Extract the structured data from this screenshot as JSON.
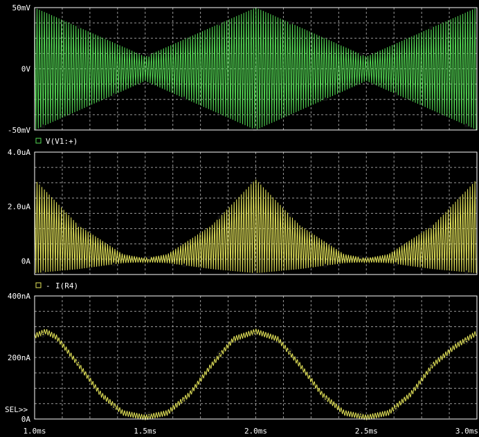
{
  "plot_area": {
    "border_color": "#ffffff",
    "grid_color": "#9a9a9a",
    "label_color": "#ffffff"
  },
  "x_axis": {
    "ticks": [
      1.0,
      1.5,
      2.0,
      2.5,
      3.0
    ],
    "tick_labels": [
      "1.0ms",
      "1.5ms",
      "2.0ms",
      "2.5ms",
      "3.0ms"
    ],
    "range_ms": [
      1.0,
      3.0
    ]
  },
  "selector_label": "SEL>>",
  "chart_data": [
    {
      "type": "line",
      "title": "",
      "legend": "V(V1:+)",
      "legend_marker": "square",
      "color": "#55dd55",
      "ylim": [
        -50,
        50
      ],
      "unit": "mV",
      "yticks": [
        -50,
        0,
        50
      ],
      "ytick_labels": [
        "-50mV",
        "0V",
        "50mV"
      ],
      "carrier_period_ms": 0.011,
      "envelope": {
        "x": [
          1.0,
          1.25,
          1.5,
          1.75,
          2.0,
          2.25,
          2.5,
          2.75,
          3.0
        ],
        "y": [
          50,
          30,
          10,
          30,
          50,
          30,
          10,
          30,
          50
        ]
      }
    },
    {
      "type": "line",
      "title": "",
      "legend": "I(R4)",
      "legend_marker": "square",
      "color": "#e6e65a",
      "ylim": [
        -0.5,
        4.0
      ],
      "unit": "uA",
      "yticks": [
        0,
        2.0,
        4.0
      ],
      "ytick_labels": [
        "0A",
        "2.0uA",
        "4.0uA"
      ],
      "carrier_period_ms": 0.011,
      "envelope_upper": {
        "x": [
          1.0,
          1.2,
          1.4,
          1.5,
          1.6,
          1.8,
          2.0,
          2.2,
          2.4,
          2.5,
          2.6,
          2.8,
          3.0
        ],
        "y": [
          3.0,
          1.3,
          0.25,
          0.1,
          0.25,
          1.3,
          3.0,
          1.3,
          0.25,
          0.1,
          0.25,
          1.3,
          3.0
        ]
      },
      "envelope_lower": {
        "x": [
          1.0,
          1.2,
          1.4,
          1.5,
          1.6,
          1.8,
          2.0,
          2.2,
          2.4,
          2.5,
          2.6,
          2.8,
          3.0
        ],
        "y": [
          -0.45,
          -0.3,
          -0.08,
          -0.05,
          -0.08,
          -0.3,
          -0.45,
          -0.3,
          -0.08,
          -0.05,
          -0.08,
          -0.3,
          -0.45
        ]
      }
    },
    {
      "type": "line",
      "title": "",
      "legend": "",
      "color": "#e6e65a",
      "ylim": [
        0,
        400
      ],
      "unit": "nA",
      "yticks": [
        0,
        200,
        400
      ],
      "ytick_labels": [
        "0A",
        "200nA",
        "400nA"
      ],
      "carrier_period_ms": 0.011,
      "series": [
        {
          "x": [
            1.0,
            1.05,
            1.1,
            1.2,
            1.3,
            1.4,
            1.5,
            1.6,
            1.7,
            1.8,
            1.9,
            2.0,
            2.1,
            2.2,
            2.3,
            2.4,
            2.5,
            2.6,
            2.7,
            2.8,
            2.9,
            3.0
          ],
          "y": [
            270,
            285,
            265,
            175,
            80,
            20,
            5,
            20,
            80,
            175,
            260,
            285,
            260,
            175,
            80,
            20,
            5,
            20,
            80,
            175,
            235,
            280
          ]
        }
      ],
      "ripple_nA": 18
    }
  ]
}
